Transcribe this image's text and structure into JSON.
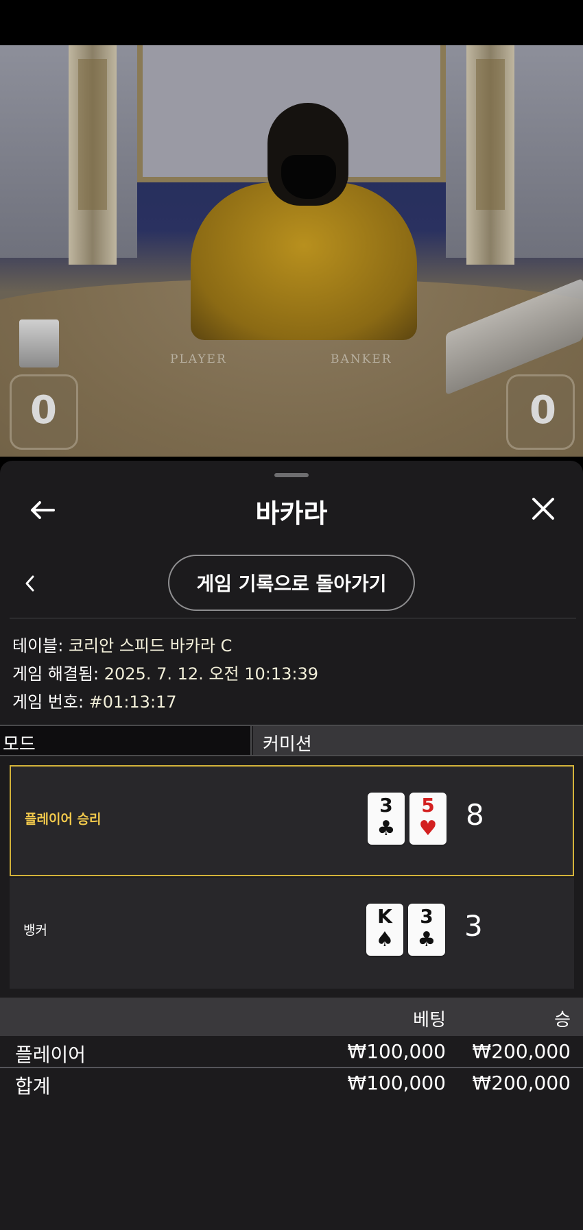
{
  "video": {
    "table_labels": {
      "player": "PLAYER",
      "banker": "BANKER"
    },
    "scores": {
      "left": "0",
      "right": "0"
    }
  },
  "header": {
    "title": "바카라",
    "back_icon": "arrow-left-icon",
    "close_icon": "close-icon"
  },
  "nav": {
    "back_chevron_icon": "chevron-left-icon",
    "back_to_history_label": "게임 기록으로 돌아가기"
  },
  "info": {
    "table_key": "테이블: ",
    "table_value": "코리안 스피드 바카라 C",
    "resolved_key": "게임 해결됨: ",
    "resolved_value": "2025. 7. 12. 오전 10:13:39",
    "number_key": "게임 번호: ",
    "number_value": "#01:13:17"
  },
  "mode": {
    "label": "모드",
    "value": "커미션"
  },
  "results": [
    {
      "label": "플레이어 승리",
      "winner": true,
      "cards": [
        {
          "rank": "3",
          "suit": "♣",
          "color": "black"
        },
        {
          "rank": "5",
          "suit": "♥",
          "color": "red"
        }
      ],
      "total": "8"
    },
    {
      "label": "뱅커",
      "winner": false,
      "cards": [
        {
          "rank": "K",
          "suit": "♠",
          "color": "black"
        },
        {
          "rank": "3",
          "suit": "♣",
          "color": "black"
        }
      ],
      "total": "3"
    }
  ],
  "bets": {
    "header": {
      "bet": "베팅",
      "win": "승"
    },
    "rows": [
      {
        "name": "플레이어",
        "bet": "₩100,000",
        "win": "₩200,000"
      }
    ],
    "total": {
      "name": "합계",
      "bet": "₩100,000",
      "win": "₩200,000"
    }
  },
  "colors": {
    "sheet_bg": "#1c1b1d",
    "win_accent": "#d4b33a",
    "win_label": "#f2c94c",
    "card_red": "#d32020"
  }
}
